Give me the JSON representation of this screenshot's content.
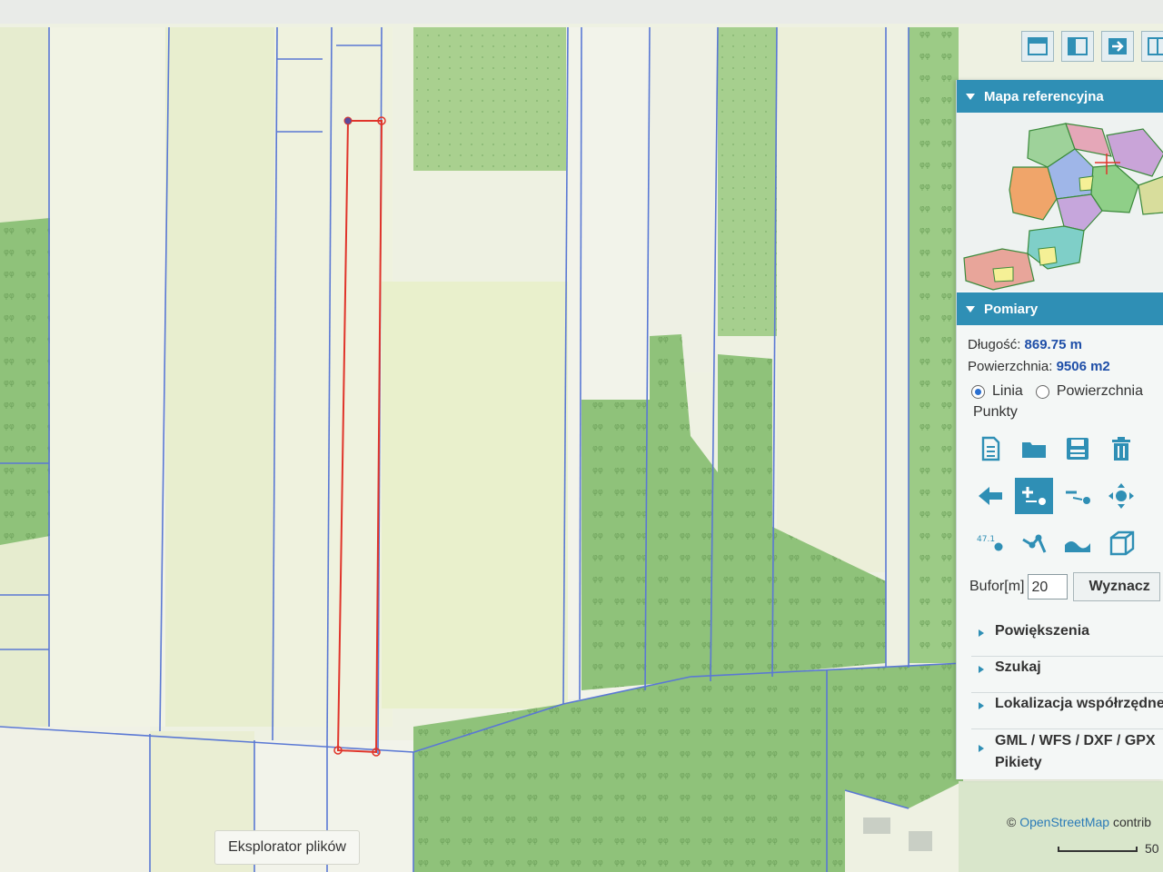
{
  "toolbar_top": {
    "icons": [
      "layout-top-icon",
      "layout-side-icon",
      "export-arrow-icon",
      "grid-icon"
    ]
  },
  "panel": {
    "ref_map": {
      "title": "Mapa referencyjna"
    },
    "measure": {
      "title": "Pomiary",
      "length_label": "Długość:",
      "length_value": "869.75 m",
      "area_label": "Powierzchnia:",
      "area_value": "9506 m2",
      "mode_line_label": "Linia",
      "mode_area_label": "Powierzchnia",
      "mode_selected": "Linia",
      "points_label": "Punkty",
      "tools": [
        "new-document-icon",
        "open-folder-icon",
        "save-icon",
        "trash-icon",
        "undo-arrow-icon",
        "add-point-icon",
        "remove-point-icon",
        "move-icon",
        "coordinate-point-icon",
        "polyline-icon",
        "profile-icon",
        "3d-box-icon"
      ],
      "active_tool": "add-point-icon",
      "buffer_label": "Bufor[m]",
      "buffer_value": "20",
      "buffer_button": "Wyznacz"
    },
    "sections": [
      {
        "label": "Powiększenia"
      },
      {
        "label": "Szukaj"
      },
      {
        "label": "Lokalizacja współrzędne"
      },
      {
        "label": "GML / WFS / DXF / GPX",
        "label2": "Pikiety"
      }
    ]
  },
  "map": {
    "explorer_button": "Eksplorator plików",
    "attribution_prefix": "©",
    "attribution_link": "OpenStreetMap",
    "attribution_suffix": "contrib",
    "scale_label": "50",
    "colors": {
      "parcel_line": "#5a78d4",
      "measure_line": "#e0342a",
      "forest": "#8fc27a",
      "field": "#eef2d8"
    }
  }
}
